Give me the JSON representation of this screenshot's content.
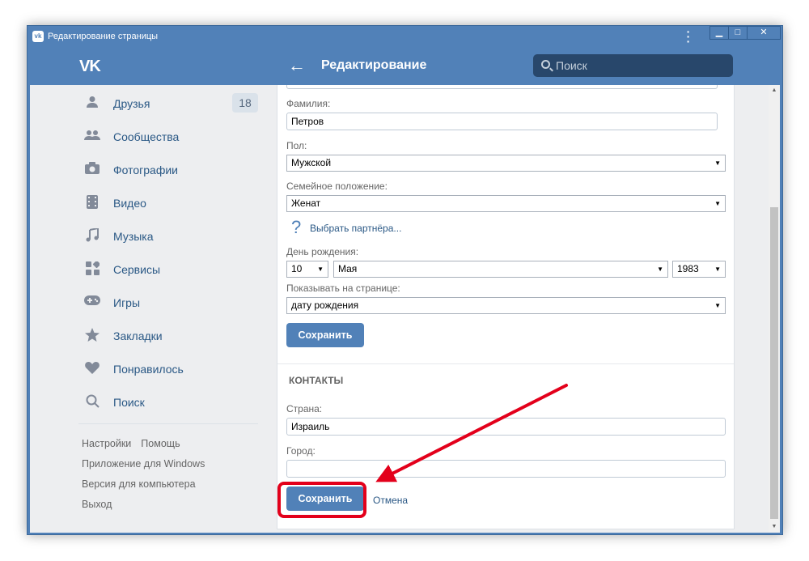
{
  "window": {
    "title": "Редактирование страницы",
    "title_icon": "vk-logo-small",
    "buttons": [
      "▁",
      "□",
      "✕"
    ]
  },
  "header": {
    "logo": "VK",
    "back_icon": "←",
    "title": "Редактирование",
    "search_placeholder": "Поиск"
  },
  "sidebar": {
    "items": [
      {
        "label": "Друзья",
        "icon": "user-icon",
        "glyph": "👤",
        "count": "18"
      },
      {
        "label": "Сообщества",
        "icon": "users-icon",
        "glyph": "👥"
      },
      {
        "label": "Фотографии",
        "icon": "camera-icon",
        "glyph": "📷"
      },
      {
        "label": "Видео",
        "icon": "film-icon",
        "glyph": "▦"
      },
      {
        "label": "Музыка",
        "icon": "music-icon",
        "glyph": "♫"
      },
      {
        "label": "Сервисы",
        "icon": "services-icon",
        "glyph": "▣"
      },
      {
        "label": "Игры",
        "icon": "gamepad-icon",
        "glyph": "🎮"
      },
      {
        "label": "Закладки",
        "icon": "star-icon",
        "glyph": "★"
      },
      {
        "label": "Понравилось",
        "icon": "heart-icon",
        "glyph": "♥"
      },
      {
        "label": "Поиск",
        "icon": "search-icon",
        "glyph": "○"
      }
    ],
    "footer": {
      "settings": "Настройки",
      "help": "Помощь",
      "windows_app": "Приложение для Windows",
      "desktop_version": "Версия для компьютера",
      "logout": "Выход"
    }
  },
  "form": {
    "surname_label": "Фамилия:",
    "surname_value": "Петров",
    "gender_label": "Пол:",
    "gender_value": "Мужской",
    "family_label": "Семейное положение:",
    "family_value": "Женат",
    "partner_icon": "?",
    "partner_link": "Выбрать партнёра...",
    "birthday_label": "День рождения:",
    "birth_day": "10",
    "birth_month": "Мая",
    "birth_year": "1983",
    "show_label": "Показывать на странице:",
    "show_value": "дату рождения",
    "save_label": "Сохранить"
  },
  "contacts": {
    "section_title": "КОНТАКТЫ",
    "country_label": "Страна:",
    "country_value": "Израиль",
    "city_label": "Город:",
    "city_value": "",
    "save_label": "Сохранить",
    "cancel_label": "Отмена"
  },
  "annotation": {
    "color": "#e3001b"
  }
}
